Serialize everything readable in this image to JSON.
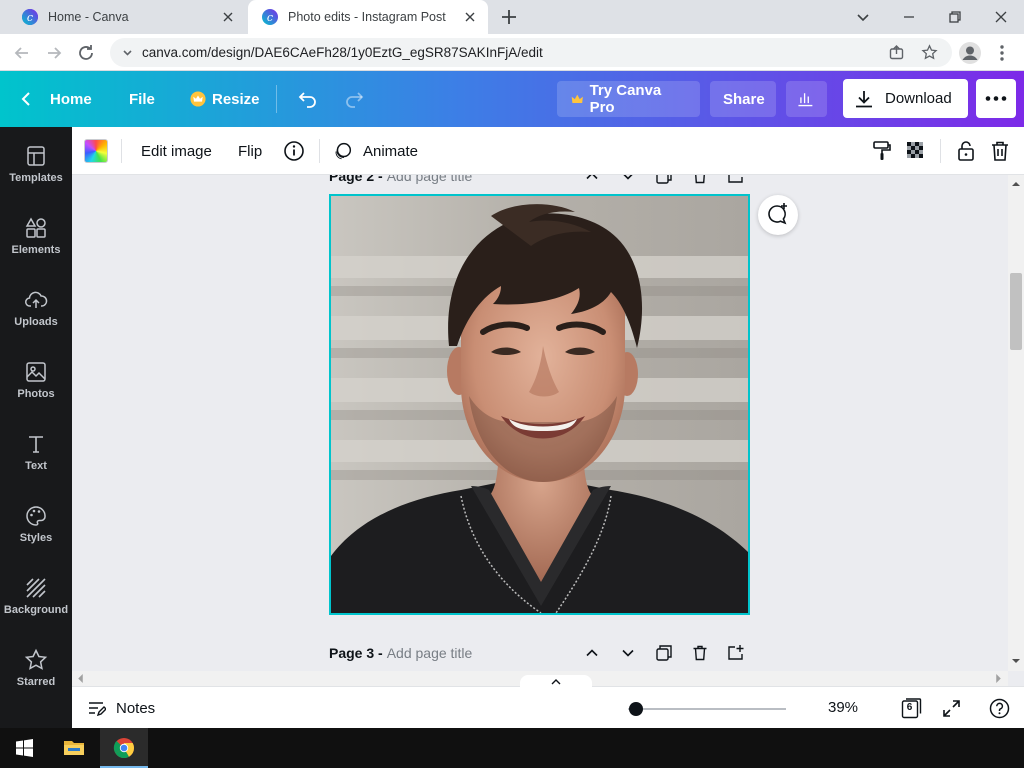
{
  "browser": {
    "tabs": [
      {
        "title": "Home - Canva",
        "active": false
      },
      {
        "title": "Photo edits - Instagram Post",
        "active": true
      }
    ],
    "url": "canva.com/design/DAE6CAeFh28/1y0EztG_egSR87SAKInFjA/edit"
  },
  "header": {
    "home_label": "Home",
    "file_label": "File",
    "resize_label": "Resize",
    "try_pro_label": "Try Canva Pro",
    "share_label": "Share",
    "download_label": "Download"
  },
  "sidebar": {
    "items": [
      {
        "label": "Templates",
        "icon": "templates-icon"
      },
      {
        "label": "Elements",
        "icon": "elements-icon"
      },
      {
        "label": "Uploads",
        "icon": "uploads-icon"
      },
      {
        "label": "Photos",
        "icon": "photos-icon"
      },
      {
        "label": "Text",
        "icon": "text-icon"
      },
      {
        "label": "Styles",
        "icon": "styles-icon"
      },
      {
        "label": "Background",
        "icon": "background-icon"
      },
      {
        "label": "Starred",
        "icon": "star-icon"
      }
    ]
  },
  "toolbar": {
    "edit_image_label": "Edit image",
    "flip_label": "Flip",
    "animate_label": "Animate"
  },
  "canvas": {
    "pages": [
      {
        "number_label": "Page 2 -",
        "title_placeholder": "Add page title",
        "selected": true,
        "image_alt": "Smiling man with dark hair in black t-shirt"
      },
      {
        "number_label": "Page 3 -",
        "title_placeholder": "Add page title",
        "selected": false
      }
    ]
  },
  "footer": {
    "notes_label": "Notes",
    "zoom": "39%",
    "zoom_fraction": 0.05,
    "page_count": "6"
  },
  "colors": {
    "brand_teal": "#00c4cc",
    "brand_purple": "#7d2ae8",
    "sidebar_bg": "#18191b",
    "selection": "#00c4cc"
  }
}
